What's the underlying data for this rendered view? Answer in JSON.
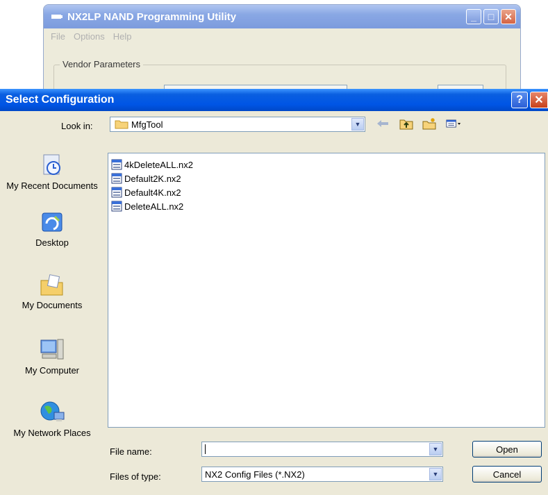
{
  "background_window": {
    "title": "NX2LP NAND Programming Utility",
    "menu": [
      "File",
      "Options",
      "Help"
    ],
    "group_label": "Vendor Parameters"
  },
  "dialog": {
    "title": "Select Configuration",
    "help_label": "?",
    "close_label": "X",
    "look_in_label": "Look in:",
    "look_in_value": "MfgTool",
    "places": [
      {
        "label": "My Recent Documents",
        "icon": "recent-documents-icon"
      },
      {
        "label": "Desktop",
        "icon": "desktop-icon"
      },
      {
        "label": "My Documents",
        "icon": "my-documents-icon"
      },
      {
        "label": "My Computer",
        "icon": "my-computer-icon"
      },
      {
        "label": "My Network Places",
        "icon": "network-places-icon"
      }
    ],
    "files": [
      "4kDeleteALL.nx2",
      "Default2K.nx2",
      "Default4K.nx2",
      "DeleteALL.nx2"
    ],
    "file_name_label": "File name:",
    "file_name_value": "",
    "files_of_type_label": "Files of type:",
    "files_of_type_value": "NX2 Config Files (*.NX2)",
    "open_label": "Open",
    "cancel_label": "Cancel"
  },
  "colors": {
    "titlebar_blue": "#0055e5",
    "dialog_bg": "#ece9d8",
    "close_red": "#c8401a"
  }
}
